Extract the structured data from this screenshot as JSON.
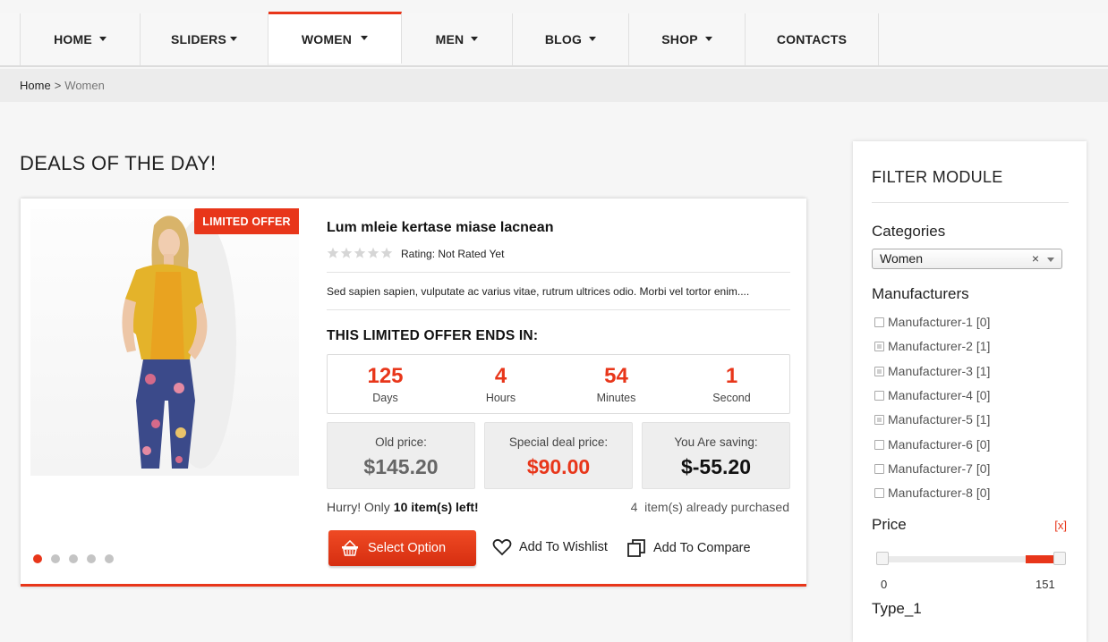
{
  "nav": {
    "items": [
      {
        "label": "HOME",
        "caret": true,
        "active": false
      },
      {
        "label": "SLIDERS",
        "caret": true,
        "active": false
      },
      {
        "label": "WOMEN",
        "caret": true,
        "active": true
      },
      {
        "label": "MEN",
        "caret": true,
        "active": false
      },
      {
        "label": "BLOG",
        "caret": true,
        "active": false
      },
      {
        "label": "SHOP",
        "caret": true,
        "active": false
      },
      {
        "label": "CONTACTS",
        "caret": false,
        "active": false
      }
    ]
  },
  "breadcrumb": {
    "home": "Home",
    "separator": ">",
    "current": "Women"
  },
  "deals": {
    "heading": "DEALS OF THE DAY!",
    "badge": "LIMITED OFFER",
    "product_title": "Lum mleie kertase miase lacnean",
    "rating_text": "Rating: Not Rated Yet",
    "stars_filled": 0,
    "description": "Sed sapien sapien, vulputate ac varius vitae, rutrum ultrices odio. Morbi vel tortor enim....",
    "countdown_heading": "THIS LIMITED OFFER ENDS IN:",
    "countdown": [
      {
        "value": "125",
        "label": "Days"
      },
      {
        "value": "4",
        "label": "Hours"
      },
      {
        "value": "54",
        "label": "Minutes"
      },
      {
        "value": "1",
        "label": "Second"
      }
    ],
    "prices": {
      "old_label": "Old price:",
      "old_value": "$145.20",
      "deal_label": "Special deal price:",
      "deal_value": "$90.00",
      "saving_label": "You Are saving:",
      "saving_value": "$-55.20"
    },
    "hurry_prefix": "Hurry! Only",
    "hurry_count": "10 item(s) left!",
    "purchased_count": "4",
    "purchased_text": "item(s) already purchased",
    "select_button": "Select Option",
    "wishlist": "Add To Wishlist",
    "compare": "Add To Compare",
    "slides": 5,
    "active_slide": 0,
    "accent": "#e8361a"
  },
  "filter": {
    "title": "FILTER MODULE",
    "categories_label": "Categories",
    "category_selected": "Women",
    "category_clear": "×",
    "manufacturers_label": "Manufacturers",
    "manufacturers": [
      "Manufacturer-1 [0]",
      "Manufacturer-2 [1]",
      "Manufacturer-3 [1]",
      "Manufacturer-4 [0]",
      "Manufacturer-5 [1]",
      "Manufacturer-6 [0]",
      "Manufacturer-7 [0]",
      "Manufacturer-8 [0]"
    ],
    "price_label": "Price",
    "price_clear": "[x]",
    "price_min": "0",
    "price_max": "151",
    "price_selected_from_fraction": 0.8,
    "type_label": "Type_1"
  }
}
